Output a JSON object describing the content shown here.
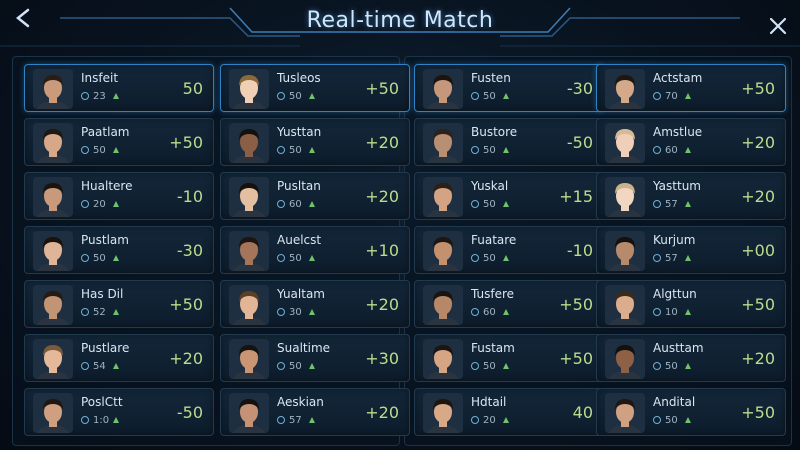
{
  "title": "Real-time Match",
  "colors": {
    "accent": "#2f82c4",
    "score": "#b9dd8d",
    "level_up": "#6fc36a",
    "background": "#08121e"
  },
  "back_icon": "chevron-left-icon",
  "close_icon": "close-icon",
  "players": [
    {
      "name": "Insfeit",
      "level": "23",
      "score": "50",
      "skin": "#c99b7a",
      "hair": "#2a1d14"
    },
    {
      "name": "Tusleos",
      "level": "50",
      "score": "+50",
      "skin": "#f0d0b4",
      "hair": "#8a6a3a"
    },
    {
      "name": "Fusten",
      "level": "50",
      "score": "-30",
      "skin": "#c6977a",
      "hair": "#1c140e"
    },
    {
      "name": "Actstam",
      "level": "70",
      "score": "+50",
      "skin": "#d3a98a",
      "hair": "#1e1610"
    },
    {
      "name": "Paatlam",
      "level": "50",
      "score": "+50",
      "skin": "#d6a788",
      "hair": "#1f1712"
    },
    {
      "name": "Yusttan",
      "level": "50",
      "score": "+20",
      "skin": "#8a5f45",
      "hair": "#141010"
    },
    {
      "name": "Bustore",
      "level": "50",
      "score": "-50",
      "skin": "#b98f74",
      "hair": "#2a221c"
    },
    {
      "name": "Amstlue",
      "level": "60",
      "score": "+20",
      "skin": "#f0cfb8",
      "hair": "#d4bb95"
    },
    {
      "name": "Hualtere",
      "level": "20",
      "score": "-10",
      "skin": "#c89a7b",
      "hair": "#1a1410"
    },
    {
      "name": "Pusltan",
      "level": "60",
      "score": "+20",
      "skin": "#e4bea0",
      "hair": "#15110e"
    },
    {
      "name": "Yuskal",
      "level": "50",
      "score": "+15",
      "skin": "#d3a383",
      "hair": "#2b2018"
    },
    {
      "name": "Yasttum",
      "level": "57",
      "score": "+20",
      "skin": "#f1d6c2",
      "hair": "#c9b18a"
    },
    {
      "name": "Pustlam",
      "level": "50",
      "score": "-30",
      "skin": "#e0b497",
      "hair": "#1b120d"
    },
    {
      "name": "Auelcst",
      "level": "50",
      "score": "+10",
      "skin": "#a57559",
      "hair": "#1c1511"
    },
    {
      "name": "Fuatare",
      "level": "50",
      "score": "-10",
      "skin": "#c4916f",
      "hair": "#1d1612"
    },
    {
      "name": "Kurjum",
      "level": "57",
      "score": "+00",
      "skin": "#b88a6c",
      "hair": "#141110"
    },
    {
      "name": "Has Dil",
      "level": "52",
      "score": "+50",
      "skin": "#c19474",
      "hair": "#241b14"
    },
    {
      "name": "Yualtam",
      "level": "30",
      "score": "+20",
      "skin": "#e1b596",
      "hair": "#5c3f25"
    },
    {
      "name": "Tusfere",
      "level": "60",
      "score": "+50",
      "skin": "#b68868",
      "hair": "#1a1411"
    },
    {
      "name": "Algttun",
      "level": "10",
      "score": "+50",
      "skin": "#dcad8c",
      "hair": "#3a2a1d"
    },
    {
      "name": "Pustlare",
      "level": "54",
      "score": "+20",
      "skin": "#e3b99a",
      "hair": "#7a5a3a"
    },
    {
      "name": "Sualtime",
      "level": "50",
      "score": "+30",
      "skin": "#c99572",
      "hair": "#161210"
    },
    {
      "name": "Fustam",
      "level": "50",
      "score": "+50",
      "skin": "#d6a584",
      "hair": "#1c1511"
    },
    {
      "name": "Austtam",
      "level": "50",
      "score": "+20",
      "skin": "#8e6045",
      "hair": "#131010"
    },
    {
      "name": "PoslCtt",
      "level": "1:0",
      "score": "-50",
      "skin": "#cf9f80",
      "hair": "#1f1812"
    },
    {
      "name": "Aeskian",
      "level": "57",
      "score": "+20",
      "skin": "#c69275",
      "hair": "#141111"
    },
    {
      "name": "Hdtail",
      "level": "20",
      "score": "40",
      "skin": "#d8a986",
      "hair": "#1d1510"
    },
    {
      "name": "Andital",
      "level": "50",
      "score": "+50",
      "skin": "#d0a083",
      "hair": "#1e1712"
    }
  ]
}
